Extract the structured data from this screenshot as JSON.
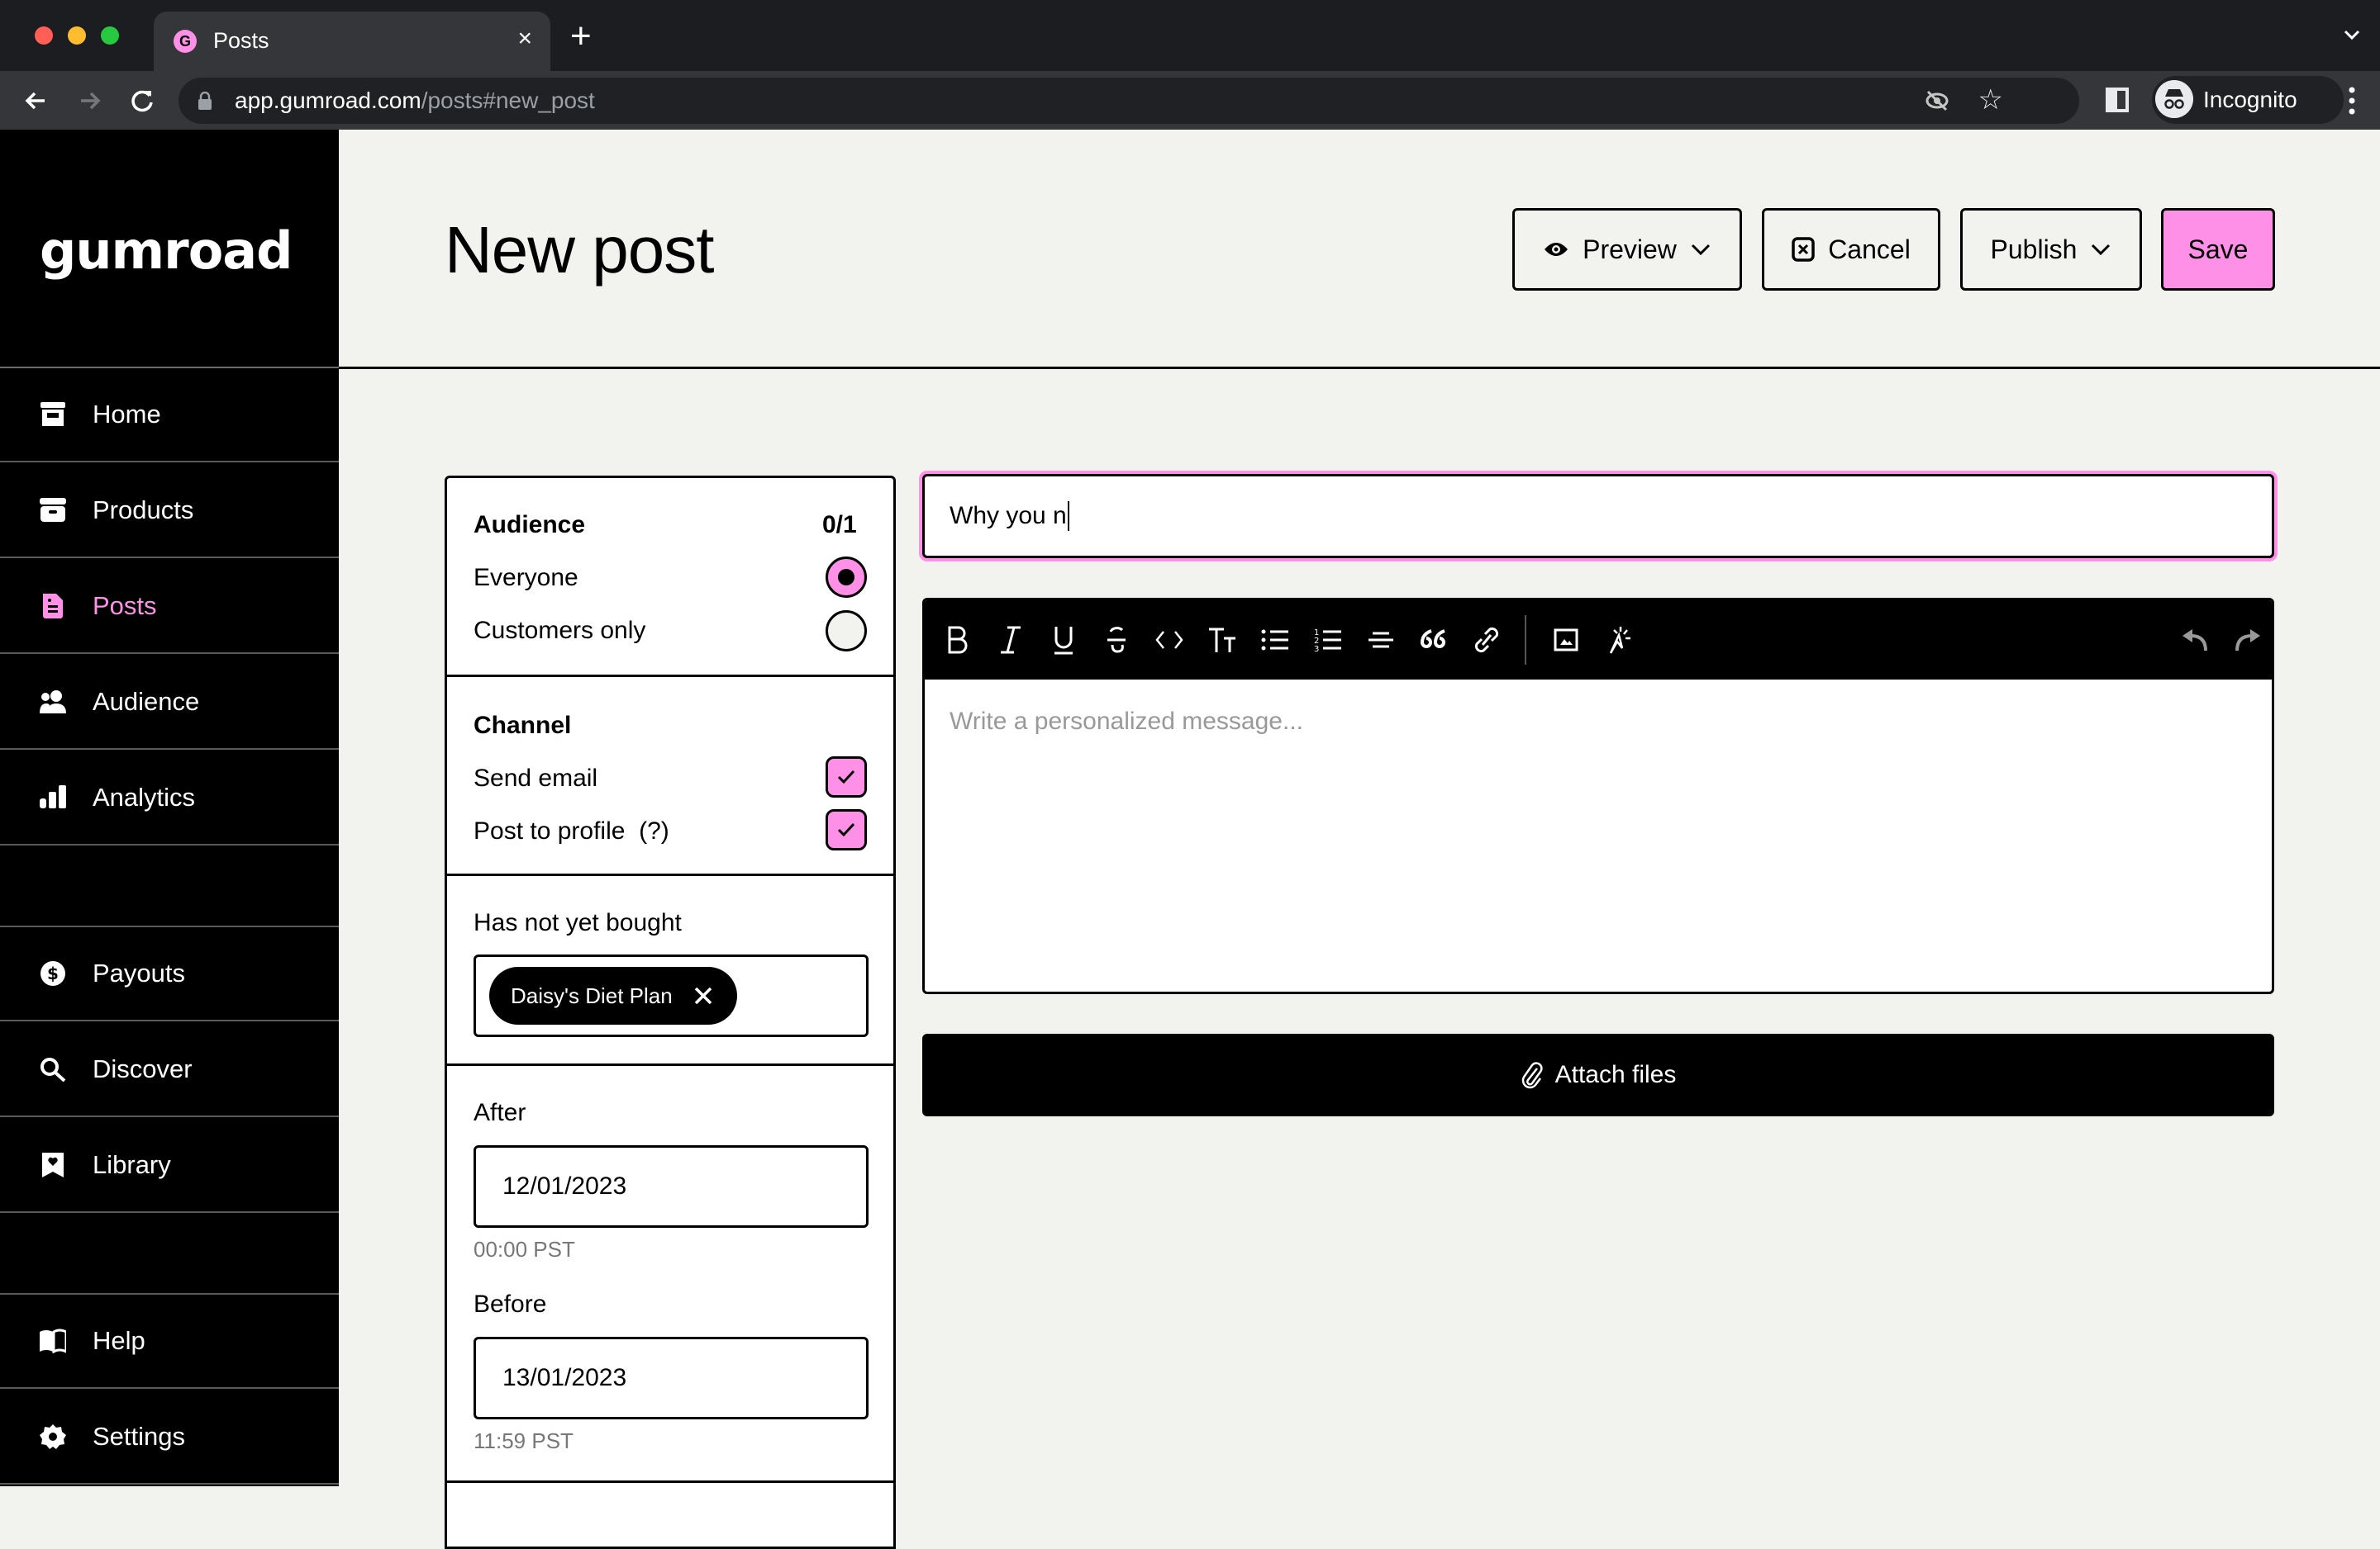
{
  "browser": {
    "tab_title": "Posts",
    "tab_favicon_letter": "G",
    "url_host": "app.gumroad.com",
    "url_path": "/posts#new_post",
    "profile_label": "Incognito",
    "close_glyph": "×",
    "new_tab_glyph": "+"
  },
  "sidebar": {
    "logo": "gumroad",
    "items": [
      {
        "label": "Home",
        "icon": "store-icon",
        "active": false
      },
      {
        "label": "Products",
        "icon": "archive-box-icon",
        "active": false
      },
      {
        "label": "Posts",
        "icon": "document-icon",
        "active": true
      },
      {
        "label": "Audience",
        "icon": "people-icon",
        "active": false
      },
      {
        "label": "Analytics",
        "icon": "bar-chart-icon",
        "active": false
      },
      {
        "label": "Payouts",
        "icon": "dollar-circle-icon",
        "active": false
      },
      {
        "label": "Discover",
        "icon": "search-icon",
        "active": false
      },
      {
        "label": "Library",
        "icon": "bookmark-heart-icon",
        "active": false
      },
      {
        "label": "Help",
        "icon": "book-icon",
        "active": false
      },
      {
        "label": "Settings",
        "icon": "gear-icon",
        "active": false
      }
    ]
  },
  "header": {
    "title": "New post",
    "buttons": {
      "preview": "Preview",
      "cancel": "Cancel",
      "publish": "Publish",
      "save": "Save"
    }
  },
  "audience": {
    "title": "Audience",
    "count": "0/1",
    "options": [
      {
        "label": "Everyone",
        "selected": true
      },
      {
        "label": "Customers only",
        "selected": false
      }
    ]
  },
  "channel": {
    "title": "Channel",
    "options": [
      {
        "label": "Send email",
        "checked": true
      },
      {
        "label": "Post to profile",
        "help": "(?)",
        "checked": true
      }
    ]
  },
  "filters": {
    "has_not_bought_label": "Has not yet bought",
    "has_not_bought_products": [
      "Daisy's Diet Plan"
    ],
    "after_label": "After",
    "after_date": "12/01/2023",
    "after_time": "00:00 PST",
    "before_label": "Before",
    "before_date": "13/01/2023",
    "before_time": "11:59 PST"
  },
  "editor": {
    "title_value": "Why you n",
    "body_placeholder": "Write a personalized message...",
    "toolbar": [
      "bold",
      "italic",
      "underline",
      "strikethrough",
      "code",
      "text-size",
      "bullet-list",
      "numbered-list",
      "horizontal-rule",
      "quote",
      "link",
      "image",
      "embed",
      "undo",
      "redo"
    ],
    "attach_label": "Attach files"
  },
  "colors": {
    "accent": "#ff90e8",
    "background": "#f2f2ef",
    "sidebar": "#000000"
  }
}
